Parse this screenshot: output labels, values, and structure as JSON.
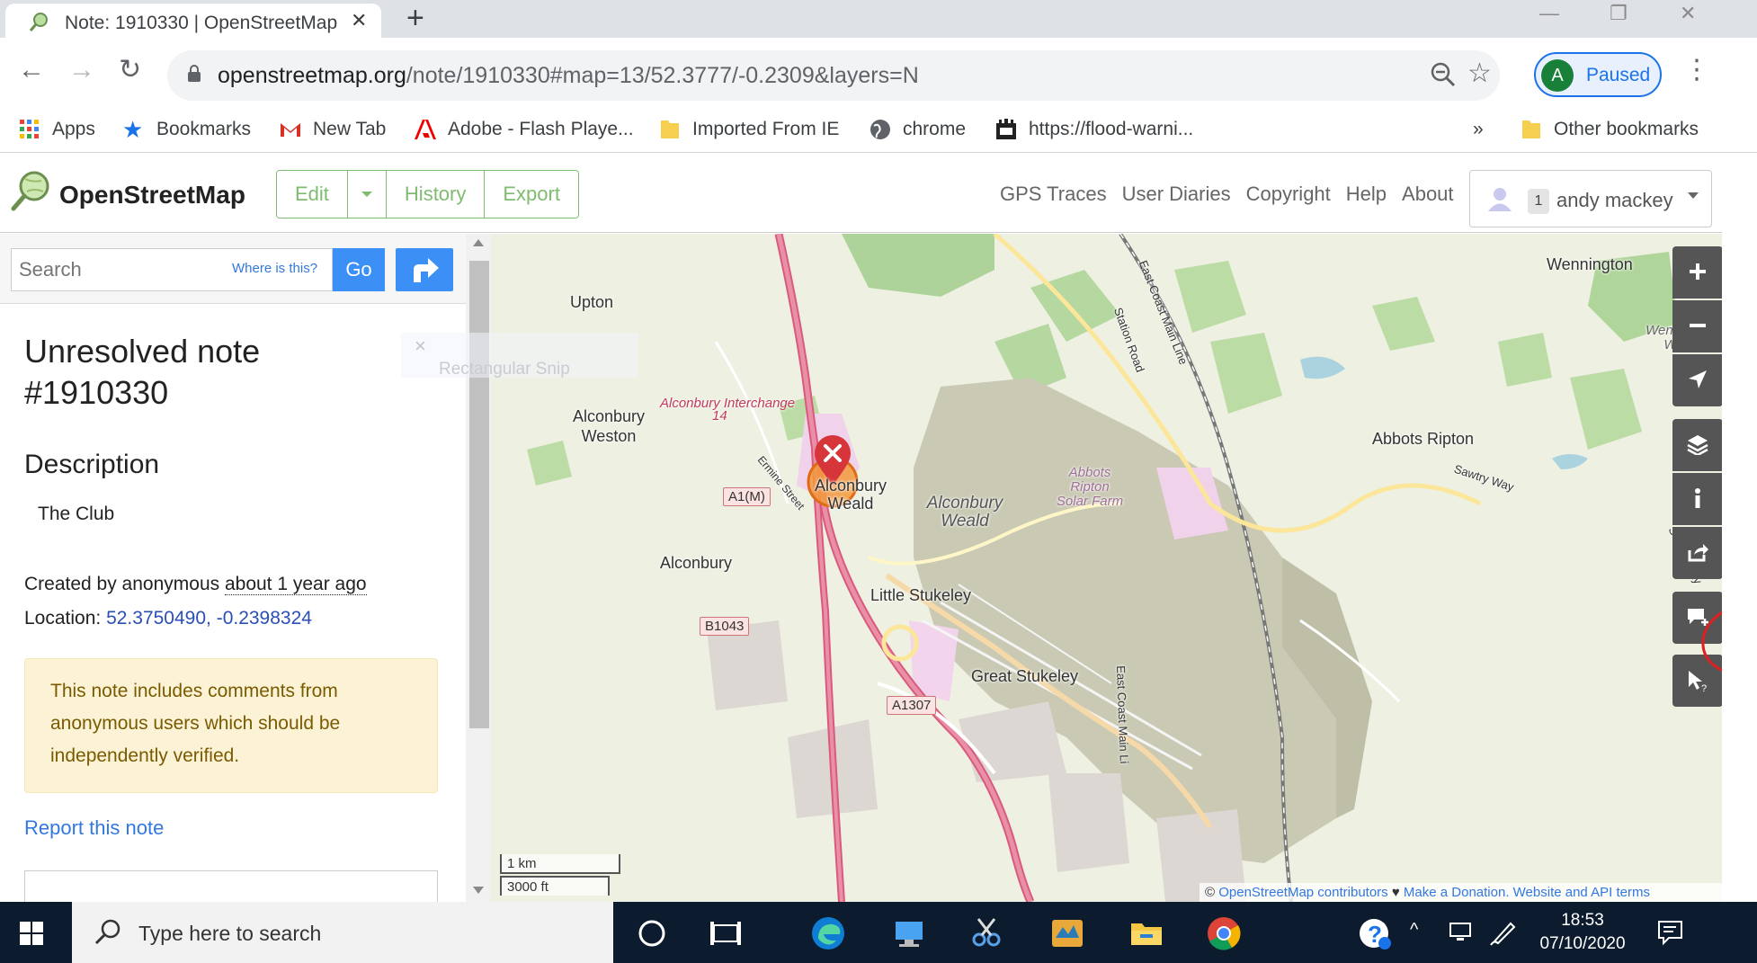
{
  "browser": {
    "tab_title": "Note: 1910330 | OpenStreetMap",
    "url_domain": "openstreetmap.org",
    "url_path": "/note/1910330#map=13/52.3777/-0.2309&layers=N",
    "profile_initial": "A",
    "profile_status": "Paused",
    "bookmarks": [
      {
        "label": "Apps",
        "icon": "apps-grid-icon"
      },
      {
        "label": "Bookmarks",
        "icon": "star-icon"
      },
      {
        "label": "New Tab",
        "icon": "gmail-icon"
      },
      {
        "label": "Adobe - Flash Playe...",
        "icon": "adobe-icon"
      },
      {
        "label": "Imported From IE",
        "icon": "folder-icon"
      },
      {
        "label": "chrome",
        "icon": "globe-icon"
      },
      {
        "label": "https://flood-warni...",
        "icon": "crest-icon"
      }
    ],
    "bookmarks_more": "»",
    "other_bookmarks": "Other bookmarks"
  },
  "osm": {
    "brand": "OpenStreetMap",
    "edit": "Edit",
    "history": "History",
    "export": "Export",
    "nav_links": [
      "GPS Traces",
      "User Diaries",
      "Copyright",
      "Help",
      "About"
    ],
    "user_count": "1",
    "username": "andy mackey"
  },
  "sidebar": {
    "search_placeholder": "Search",
    "where_is_this": "Where is this?",
    "go": "Go",
    "note_title": "Unresolved note #1910330",
    "description_heading": "Description",
    "description": "The Club",
    "created_prefix": "Created by anonymous ",
    "created_time": "about 1 year ago",
    "location_prefix": "Location: ",
    "location_coords": "52.3750490, -0.2398324",
    "warning": "This note includes comments from anonymous users which should be independently verified.",
    "report_link": "Report this note"
  },
  "snip": {
    "close": "×",
    "label": "Rectangular Snip"
  },
  "map": {
    "labels": {
      "upton": "Upton",
      "wennington": "Wennington",
      "wennington_wood": "Wennington Wood",
      "abbots_ripton": "Abbots Ripton",
      "sawtry_way": "Sawtry Way",
      "sawtry_way_2": "Sawtry Way",
      "east_coast_main_line": "East Coast Main Line",
      "station_road": "Station Road",
      "alconbury_weston": "Alconbury Weston",
      "alconbury_interchange": "Alconbury Interchange",
      "junction": "14",
      "ermine_street": "Ermine Street",
      "alconbury_weald": "Alconbury Weald",
      "alconbury_weald_area": "Alconbury Weald",
      "abbots_ripton_solar_farm": "Abbots Ripton Solar Farm",
      "alconbury": "Alconbury",
      "little_stukeley": "Little Stukeley",
      "great_stukeley": "Great Stukeley",
      "east_coast_main_line_2": "East Coast Main Li"
    },
    "shields": {
      "a1m": "A1(M)",
      "b1043": "B1043",
      "a1307": "A1307"
    },
    "scale_km": "1 km",
    "scale_ft": "3000 ft",
    "attribution_prefix": "© ",
    "attribution_contrib": "OpenStreetMap contributors",
    "attribution_heart": " ♥ ",
    "attribution_donate": "Make a Donation",
    "attribution_terms": ". Website and API terms"
  },
  "taskbar": {
    "search_text": "Type here to search",
    "time": "18:53",
    "date": "07/10/2020"
  }
}
